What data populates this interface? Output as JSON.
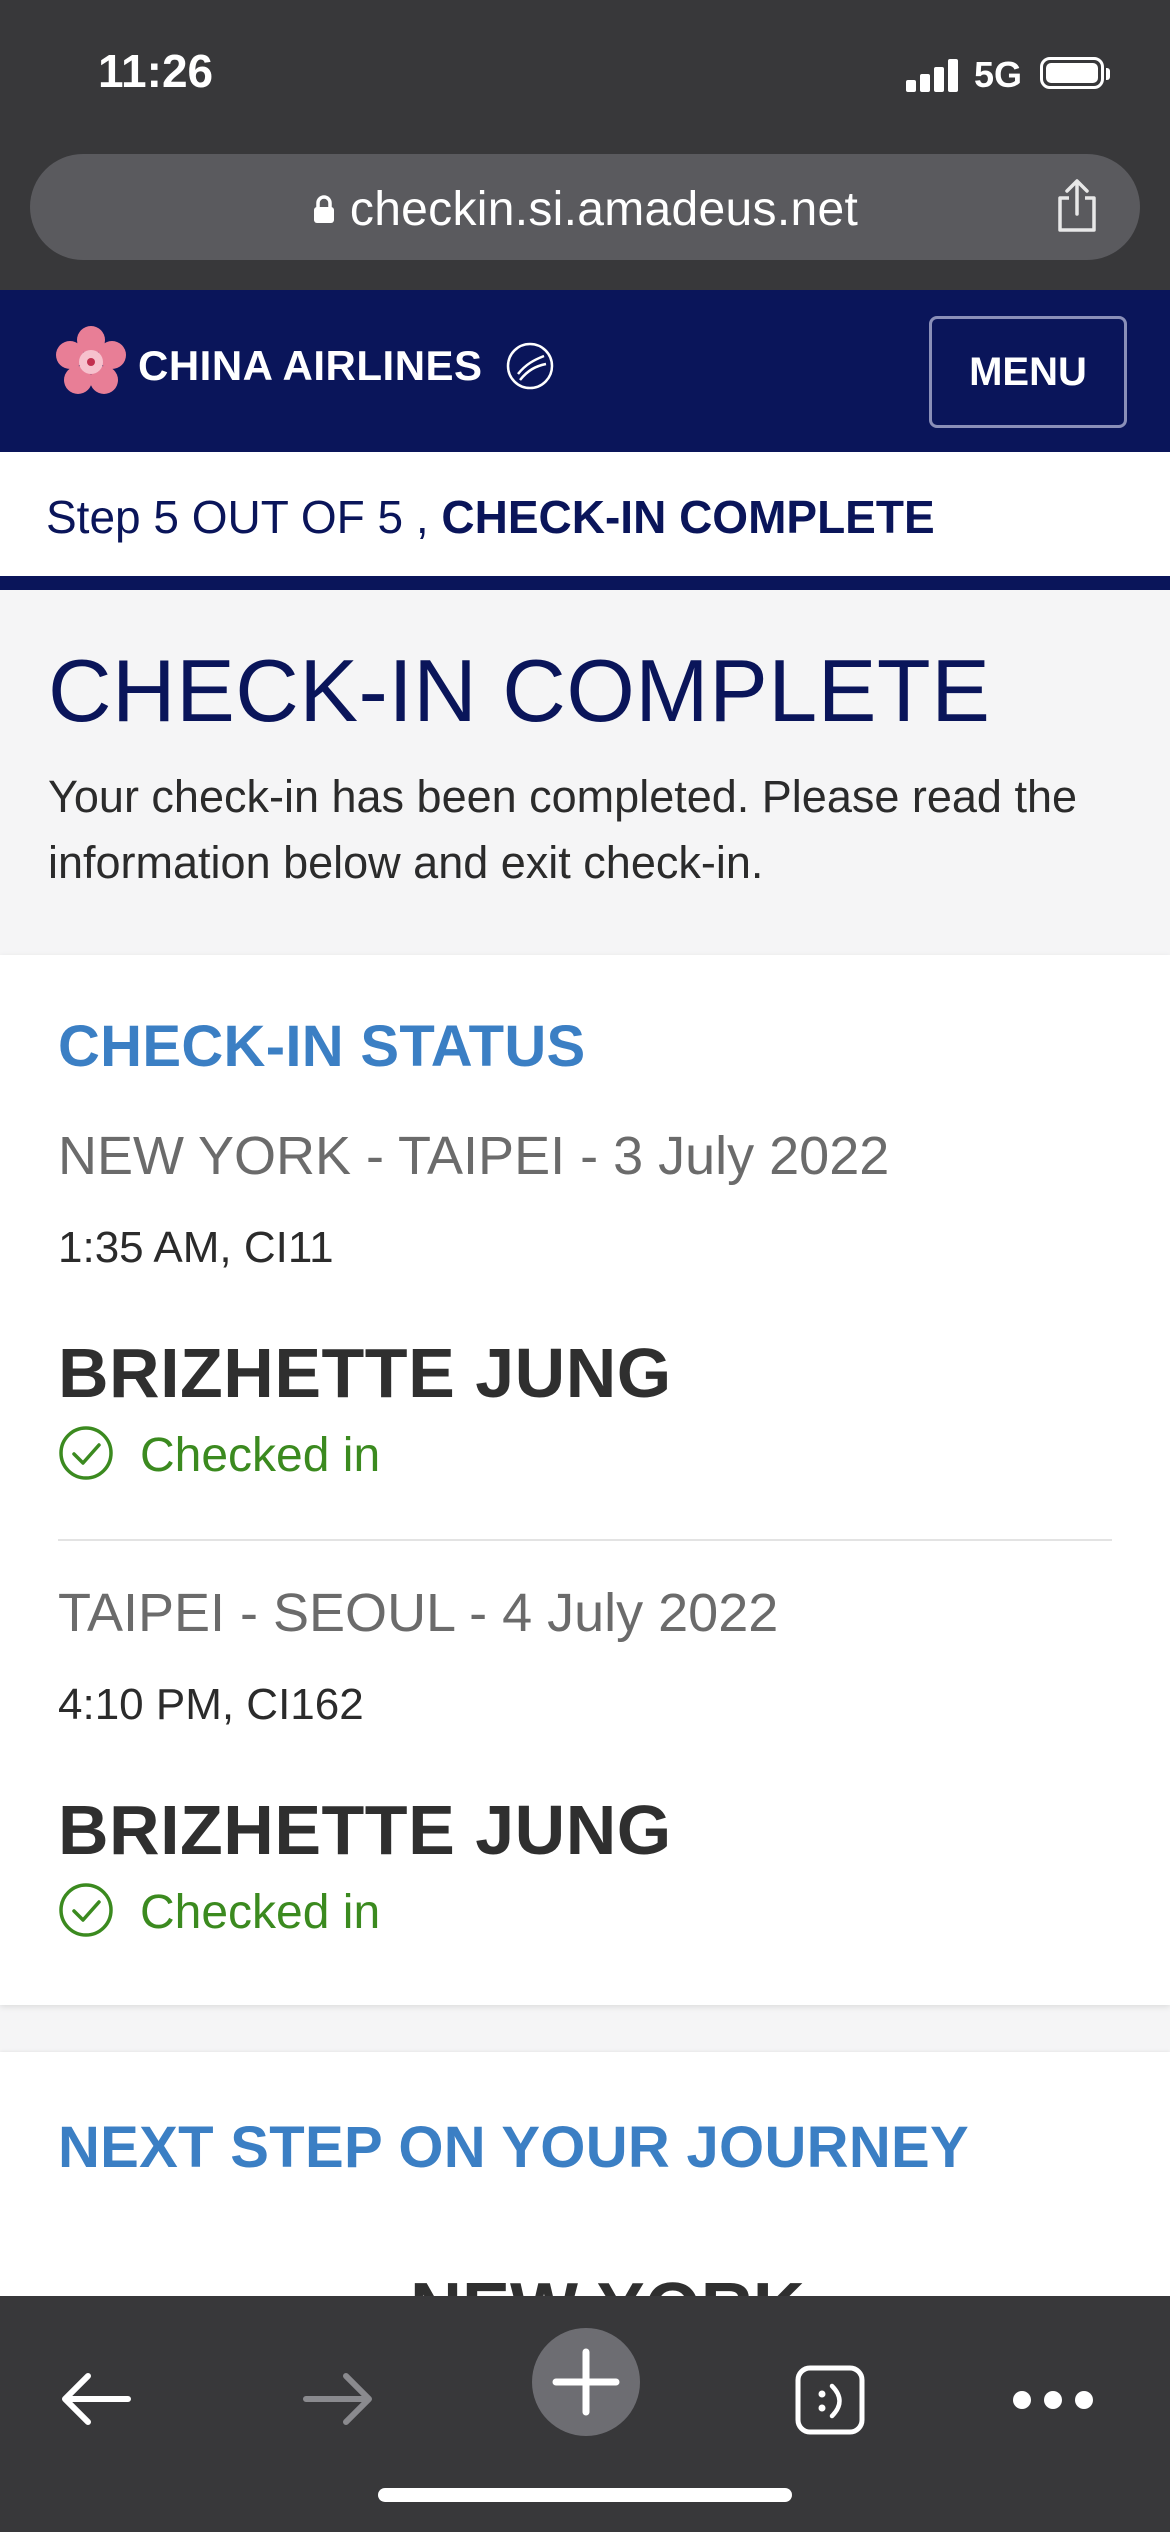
{
  "status_bar": {
    "time": "11:26",
    "network": "5G"
  },
  "browser": {
    "url": "checkin.si.amadeus.net"
  },
  "header": {
    "brand": "CHINA AIRLINES",
    "menu_label": "MENU",
    "colors": {
      "navy": "#0a155a",
      "accent_blue": "#3b7fc4",
      "success_green": "#3b8a1f"
    }
  },
  "progress": {
    "prefix": "Step 5 OUT OF 5 ,",
    "current": "CHECK-IN COMPLETE"
  },
  "intro": {
    "title": "CHECK-IN COMPLETE",
    "message": "Your check-in has been completed. Please read the information below and exit check-in."
  },
  "status_section": {
    "heading": "CHECK-IN STATUS",
    "flights": [
      {
        "route": "NEW YORK - TAIPEI - 3 July 2022",
        "time_flight": "1:35 AM, CI11",
        "passenger": "BRIZHETTE JUNG",
        "status": "Checked in"
      },
      {
        "route": "TAIPEI - SEOUL - 4 July 2022",
        "time_flight": "4:10 PM, CI162",
        "passenger": "BRIZHETTE JUNG",
        "status": "Checked in"
      }
    ]
  },
  "next_section": {
    "heading": "NEXT STEP ON YOUR JOURNEY",
    "first_destination": "NEW YORK"
  },
  "toolbar": {
    "icons": [
      "back-arrow-icon",
      "forward-arrow-icon",
      "new-tab-plus-icon",
      "tabs-icon",
      "more-icon"
    ]
  }
}
